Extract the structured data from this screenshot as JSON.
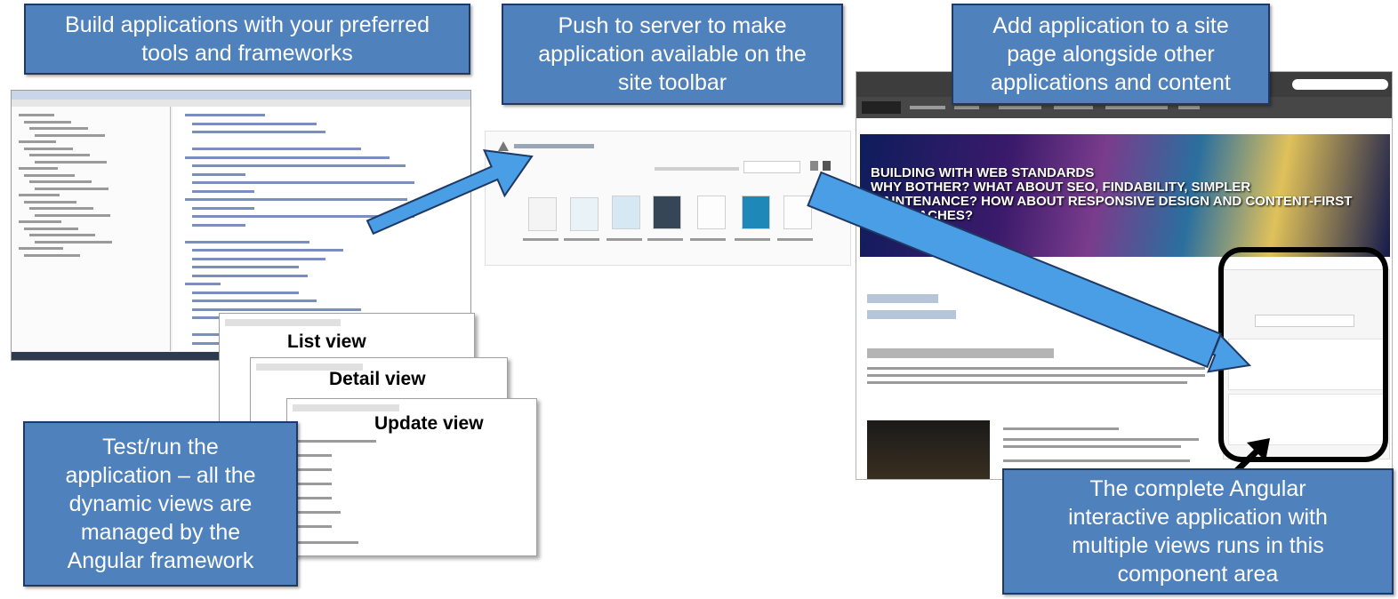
{
  "callouts": {
    "build": [
      "Build applications with your preferred",
      "tools and frameworks"
    ],
    "push": [
      "Push to server to make",
      "application available on the",
      "site toolbar"
    ],
    "add": [
      "Add application to a site",
      "page alongside other",
      "applications and content"
    ],
    "test": [
      "Test/run the",
      "application – all the",
      "dynamic views are",
      "managed by the",
      "Angular framework"
    ],
    "complete": [
      "The complete Angular",
      "interactive application with",
      "multiple views runs in this",
      "component area"
    ]
  },
  "views": {
    "list": "List view",
    "detail": "Detail view",
    "update": "Update view"
  },
  "site": {
    "banner_lines": [
      "BUILDING WITH WEB STANDARDS",
      "WHY BOTHER? WHAT ABOUT SEO, FINDABILITY, SIMPLER",
      "MAINTENANCE? HOW ABOUT RESPONSIVE DESIGN AND CONTENT-FIRST",
      "APPROACHES?"
    ]
  },
  "colors": {
    "callout_fill": "#4f81bd",
    "callout_border": "#1f3864",
    "arrow_fill": "#4a9ee6",
    "arrow_stroke": "#1f3864",
    "highlight_border": "#000000"
  }
}
